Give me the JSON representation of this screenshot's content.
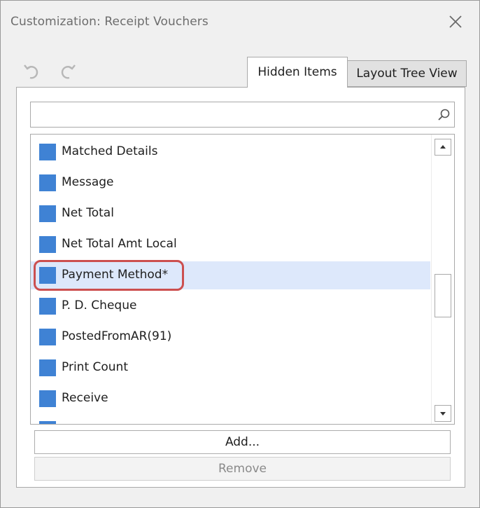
{
  "window": {
    "title": "Customization: Receipt Vouchers",
    "close_icon": "close-icon"
  },
  "toolbar": {
    "undo_icon": "undo-icon",
    "redo_icon": "redo-icon"
  },
  "tabs": [
    {
      "label": "Hidden Items",
      "active": true
    },
    {
      "label": "Layout Tree View",
      "active": false
    }
  ],
  "search": {
    "value": "",
    "placeholder": "",
    "icon": "search-icon"
  },
  "items": [
    {
      "label": "Matched Details",
      "selected": false,
      "highlighted": false
    },
    {
      "label": "Message",
      "selected": false,
      "highlighted": false
    },
    {
      "label": "Net Total",
      "selected": false,
      "highlighted": false
    },
    {
      "label": "Net Total Amt Local",
      "selected": false,
      "highlighted": false
    },
    {
      "label": "Payment Method*",
      "selected": true,
      "highlighted": true
    },
    {
      "label": "P. D. Cheque",
      "selected": false,
      "highlighted": false
    },
    {
      "label": "PostedFromAR(91)",
      "selected": false,
      "highlighted": false
    },
    {
      "label": "Print Count",
      "selected": false,
      "highlighted": false
    },
    {
      "label": "Receive",
      "selected": false,
      "highlighted": false
    }
  ],
  "buttons": {
    "add_label": "Add...",
    "remove_label": "Remove",
    "remove_enabled": false
  },
  "colors": {
    "item_icon": "#3f82d4",
    "selected_row": "#dde8fb",
    "highlight_border": "#cc4f4f"
  }
}
